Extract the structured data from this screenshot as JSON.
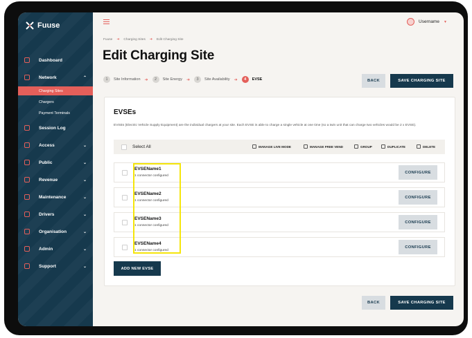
{
  "app": {
    "logo_text": "Fuuse"
  },
  "sidebar": {
    "items": [
      {
        "label": "Dashboard",
        "icon": "dashboard-icon",
        "has_chevron": false
      },
      {
        "label": "Network",
        "icon": "network-icon",
        "has_chevron": true,
        "expanded": true,
        "children": [
          {
            "label": "Charging Sites",
            "active": true
          },
          {
            "label": "Chargers"
          },
          {
            "label": "Payment Terminals"
          }
        ]
      },
      {
        "label": "Session Log",
        "icon": "bolt-icon",
        "has_chevron": false
      },
      {
        "label": "Access",
        "icon": "key-icon",
        "has_chevron": true
      },
      {
        "label": "Public",
        "icon": "globe-icon",
        "has_chevron": true
      },
      {
        "label": "Revenue",
        "icon": "tag-icon",
        "has_chevron": true
      },
      {
        "label": "Maintenance",
        "icon": "alert-icon",
        "has_chevron": true
      },
      {
        "label": "Drivers",
        "icon": "car-icon",
        "has_chevron": true
      },
      {
        "label": "Organisation",
        "icon": "building-icon",
        "has_chevron": true
      },
      {
        "label": "Admin",
        "icon": "shield-icon",
        "has_chevron": true
      },
      {
        "label": "Support",
        "icon": "phone-icon",
        "has_chevron": true
      }
    ]
  },
  "header": {
    "username": "Username"
  },
  "breadcrumb": [
    "Fuuse",
    "Charging Sites",
    "Edit Charging Site"
  ],
  "page": {
    "title": "Edit Charging Site"
  },
  "steps": [
    {
      "num": "1",
      "label": "Site Information"
    },
    {
      "num": "2",
      "label": "Site Energy"
    },
    {
      "num": "3",
      "label": "Site Availability"
    },
    {
      "num": "4",
      "label": "EVSE",
      "active": true
    }
  ],
  "actions": {
    "back": "BACK",
    "save": "SAVE CHARGING SITE"
  },
  "evses": {
    "title": "EVSEs",
    "description": "EVSEs (Electric Vehicle Supply Equipment) are the individual chargers at your site. Each EVSE is able to charge a single vehicle at one time (so a twin unit that can charge two vehicles would be 2 x EVSE).",
    "select_all": "Select All",
    "tools": {
      "manage_live_mode": "MANAGE LIVE MODE",
      "manage_free_vend": "MANAGE FREE VEND",
      "group": "GROUP",
      "duplicate": "DUPLICATE",
      "delete": "DELETE"
    },
    "items": [
      {
        "name": "EVSEName1",
        "status": "1 connector configured",
        "action": "CONFIGURE"
      },
      {
        "name": "EVSEName2",
        "status": "1 connector configured",
        "action": "CONFIGURE"
      },
      {
        "name": "EVSEName3",
        "status": "1 connector configured",
        "action": "CONFIGURE"
      },
      {
        "name": "EVSEName4",
        "status": "1 connector configured",
        "action": "CONFIGURE"
      }
    ],
    "add_button": "ADD NEW EVSE"
  },
  "colors": {
    "sidebar": "#16394d",
    "accent": "#e45f5a",
    "highlight": "#f5e50a"
  }
}
